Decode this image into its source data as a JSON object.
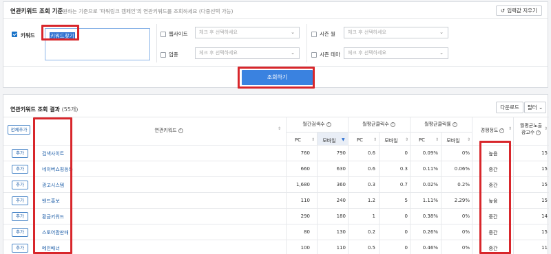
{
  "header": {
    "title": "연관키워드 조회 기준",
    "subtitle": "원하는 기준으로 '파워링크 캠페인'의 연관키워드를 조회하세요 (다중선택 가능)",
    "reset_label": "입력값 지우기"
  },
  "filters": {
    "keyword_label": "키워드",
    "keyword_value": "키워드찾기",
    "website_label": "웹사이트",
    "industry_label": "업종",
    "season_month_label": "시즌 월",
    "season_theme_label": "시즌 테마",
    "select_placeholder": "체크 후 선택하세요",
    "search_label": "조회하기"
  },
  "results": {
    "title": "연관키워드 조회 결과",
    "count": "(55개)",
    "download_label": "다운로드",
    "filter_label": "필터",
    "add_all_label": "전체추가",
    "columns": {
      "keyword": "연관키워드",
      "monthly_search": "월간검색수",
      "monthly_clicks": "월평균클릭수",
      "monthly_ctr": "월평균클릭률",
      "competition": "경쟁정도",
      "ads_line1": "월평균노출",
      "ads_line2": "광고수",
      "pc": "PC",
      "mobile": "모바일"
    },
    "add_label": "추가",
    "rows": [
      {
        "keyword": "검색사이트",
        "pc_search": "760",
        "mo_search": "790",
        "pc_click": "0.6",
        "mo_click": "0",
        "pc_ctr": "0.09%",
        "mo_ctr": "0%",
        "competition": "높음",
        "ads": "15"
      },
      {
        "keyword": "네이버쇼핑등록",
        "pc_search": "660",
        "mo_search": "630",
        "pc_click": "0.6",
        "mo_click": "0.3",
        "pc_ctr": "0.11%",
        "mo_ctr": "0.06%",
        "competition": "중간",
        "ads": "15"
      },
      {
        "keyword": "광고시스템",
        "pc_search": "1,680",
        "mo_search": "360",
        "pc_click": "0.3",
        "mo_click": "0.7",
        "pc_ctr": "0.02%",
        "mo_ctr": "0.2%",
        "competition": "중간",
        "ads": "15"
      },
      {
        "keyword": "밴드홍보",
        "pc_search": "110",
        "mo_search": "240",
        "pc_click": "1.2",
        "mo_click": "5",
        "pc_ctr": "1.11%",
        "mo_ctr": "2.29%",
        "competition": "높음",
        "ads": "15"
      },
      {
        "keyword": "황금키워드",
        "pc_search": "290",
        "mo_search": "180",
        "pc_click": "1",
        "mo_click": "0",
        "pc_ctr": "0.38%",
        "mo_ctr": "0%",
        "competition": "중간",
        "ads": "14"
      },
      {
        "keyword": "스토어팜판매",
        "pc_search": "80",
        "mo_search": "130",
        "pc_click": "0.2",
        "mo_click": "0",
        "pc_ctr": "0.26%",
        "mo_ctr": "0%",
        "competition": "중간",
        "ads": "15"
      },
      {
        "keyword": "메인배너",
        "pc_search": "100",
        "mo_search": "110",
        "pc_click": "0.5",
        "mo_click": "0",
        "pc_ctr": "0.46%",
        "mo_ctr": "0%",
        "competition": "중간",
        "ads": "11"
      }
    ]
  },
  "colors": {
    "accent": "#3a82e0",
    "annotation_red": "#d8262b",
    "link": "#1f5fa8"
  }
}
